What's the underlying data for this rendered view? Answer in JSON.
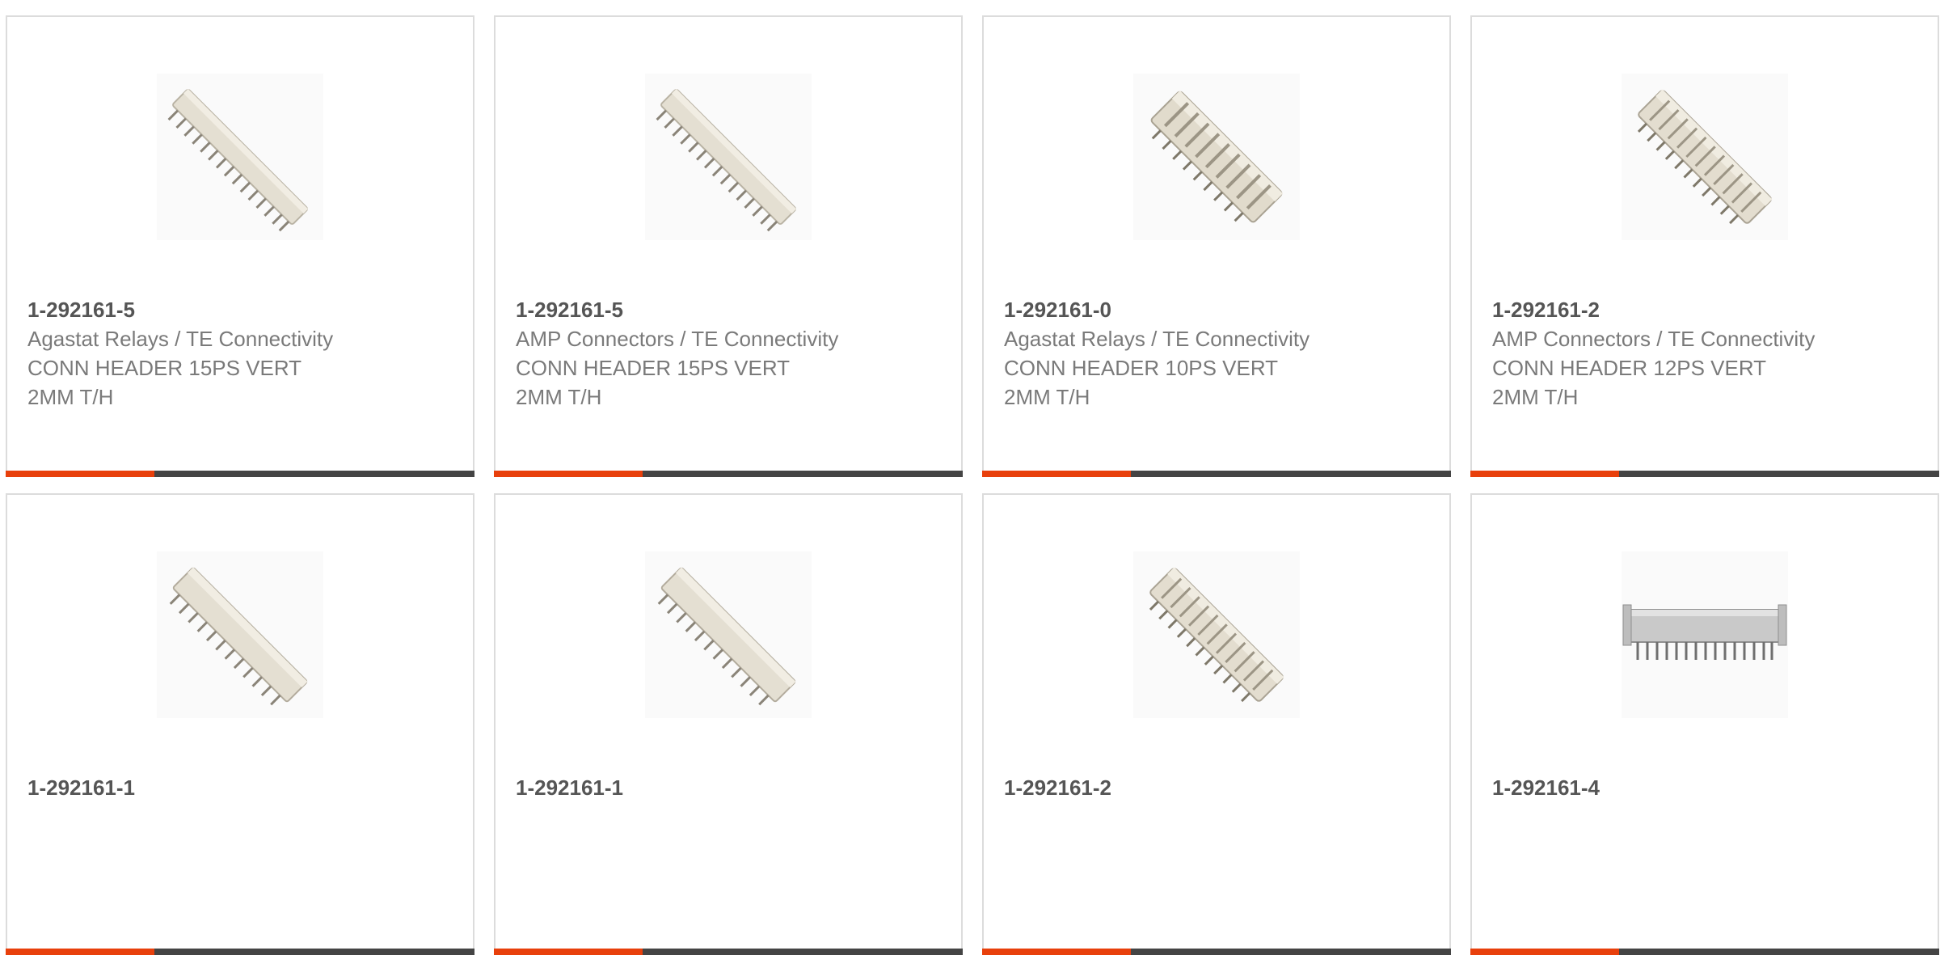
{
  "cards": [
    {
      "part_number": "1-292161-5",
      "brand": "Agastat Relays / TE Connectivity",
      "desc1": "CONN HEADER 15PS VERT",
      "desc2": "2MM T/H",
      "image": "header-diagonal"
    },
    {
      "part_number": "1-292161-5",
      "brand": "AMP Connectors / TE Connectivity",
      "desc1": "CONN HEADER 15PS VERT",
      "desc2": "2MM T/H",
      "image": "header-diagonal"
    },
    {
      "part_number": "1-292161-0",
      "brand": "Agastat Relays / TE Connectivity",
      "desc1": "CONN HEADER 10PS VERT",
      "desc2": "2MM T/H",
      "image": "header-diagonal-wide"
    },
    {
      "part_number": "1-292161-2",
      "brand": "AMP Connectors / TE Connectivity",
      "desc1": "CONN HEADER 12PS VERT",
      "desc2": "2MM T/H",
      "image": "header-diagonal-wide"
    },
    {
      "part_number": "1-292161-1",
      "brand": "",
      "desc1": "",
      "desc2": "",
      "image": "header-diagonal"
    },
    {
      "part_number": "1-292161-1",
      "brand": "",
      "desc1": "",
      "desc2": "",
      "image": "header-diagonal"
    },
    {
      "part_number": "1-292161-2",
      "brand": "",
      "desc1": "",
      "desc2": "",
      "image": "header-diagonal-wide"
    },
    {
      "part_number": "1-292161-4",
      "brand": "",
      "desc1": "",
      "desc2": "",
      "image": "header-horizontal"
    }
  ],
  "colors": {
    "accent": "#e8400c",
    "bar": "#444444",
    "border": "#dcdcdc",
    "text": "#7a7a7a"
  }
}
